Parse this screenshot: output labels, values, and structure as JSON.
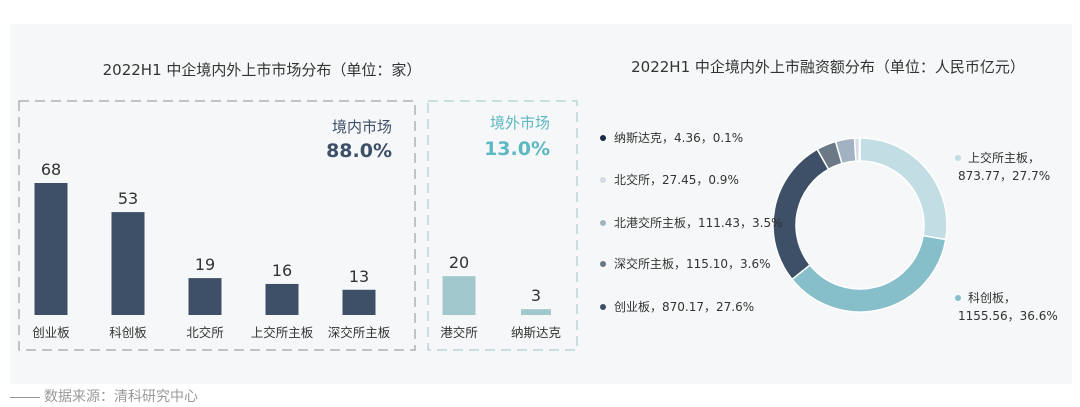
{
  "footer": {
    "source": "数据来源：清科研究中心"
  },
  "chart_data": [
    {
      "type": "bar",
      "title": "2022H1 中企境内外上市市场分布（单位：家）",
      "ylabel": "",
      "groups": [
        {
          "name": "境内市场",
          "share": "88.0%",
          "categories": [
            "创业板",
            "科创板",
            "北交所",
            "上交所主板",
            "深交所主板"
          ],
          "values": [
            68,
            53,
            19,
            16,
            13
          ]
        },
        {
          "name": "境外市场",
          "share": "13.0%",
          "categories": [
            "港交所",
            "纳斯达克"
          ],
          "values": [
            20,
            3
          ]
        }
      ],
      "colors": {
        "domestic": "#3d5068",
        "overseas": "#a1c8cd",
        "domestic_label": "#3d5068",
        "overseas_label": "#5db8c1"
      }
    },
    {
      "type": "pie",
      "title": "2022H1 中企境内外上市融资额分布（单位：人民币亿元）",
      "slices": [
        {
          "name": "上交所主板",
          "value": 873.77,
          "pct": "27.7%",
          "label_name": "上交所主板，",
          "label_value": "873.77，27.7%",
          "color": "#c2dde3"
        },
        {
          "name": "科创板",
          "value": 1155.56,
          "pct": "36.6%",
          "label_name": "科创板，",
          "label_value": "1155.56，36.6%",
          "color": "#86bfca"
        },
        {
          "name": "创业板",
          "value": 870.17,
          "pct": "27.6%",
          "label": "创业板，870.17，27.6%",
          "color": "#3d5068"
        },
        {
          "name": "深交所主板",
          "value": 115.1,
          "pct": "3.6%",
          "label": "深交所主板，115.10，3.6%",
          "color": "#6b7886"
        },
        {
          "name": "北港交所主板",
          "value": 111.43,
          "pct": "3.5%",
          "label": "北港交所主板，111.43，3.5%",
          "color": "#a3b2c2"
        },
        {
          "name": "北交所",
          "value": 27.45,
          "pct": "0.9%",
          "label": "北交所，27.45，0.9%",
          "color": "#d5dbe2"
        },
        {
          "name": "纳斯达克",
          "value": 4.36,
          "pct": "0.1%",
          "label": "纳斯达克，4.36，0.1%",
          "color": "#1b2a44"
        }
      ]
    }
  ]
}
